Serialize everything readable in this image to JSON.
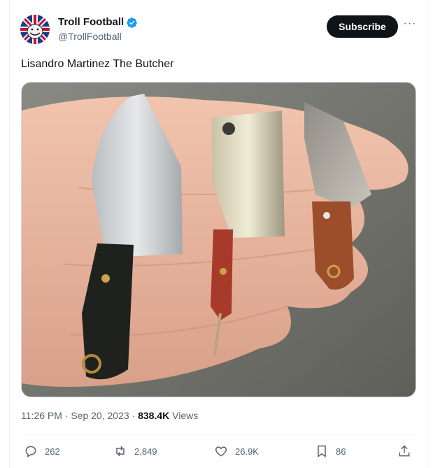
{
  "author": {
    "display_name": "Troll Football",
    "handle": "@TrollFootball",
    "verified": true,
    "avatar_icon": "union-jack-troll-avatar"
  },
  "header": {
    "subscribe_label": "Subscribe",
    "more_label": "···"
  },
  "tweet": {
    "text": "Lisandro Martinez The Butcher",
    "time": "11:26 PM",
    "date": "Sep 20, 2023",
    "separator": "·",
    "views_count": "838.4K",
    "views_label": "Views"
  },
  "media": {
    "description_icon": "photo-of-three-mini-knives-on-hand"
  },
  "actions": {
    "replies": "262",
    "reposts": "2,849",
    "likes": "26.9K",
    "bookmarks": "86"
  },
  "colors": {
    "accent": "#1d9bf0",
    "text": "#0f1419",
    "secondary": "#536471",
    "button_bg": "#0f1419"
  }
}
